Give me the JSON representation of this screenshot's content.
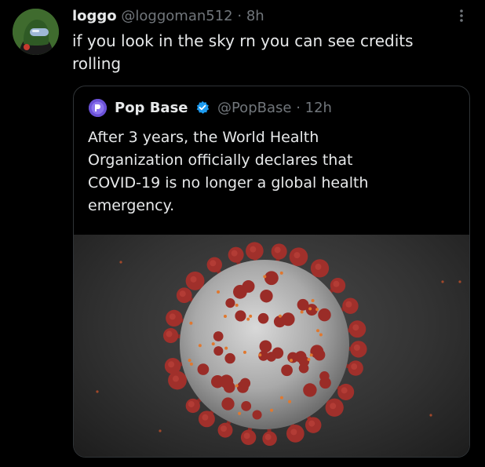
{
  "tweet": {
    "display_name": "loggo",
    "handle": "@loggoman512",
    "separator": "·",
    "time": "8h",
    "text_line1": "if you look in the sky rn you can see credits",
    "text_line2": "rolling"
  },
  "quoted_tweet": {
    "display_name": "Pop Base",
    "handle": "@PopBase",
    "separator": "·",
    "time": "12h",
    "text_line1": "After 3 years, the World Health",
    "text_line2": "Organization officially declares that",
    "text_line3": "COVID-19 is no longer a global health",
    "text_line4": "emergency.",
    "verified": true,
    "image": "coronavirus-illustration"
  },
  "icons": {
    "more": "more-vertical-icon",
    "verified": "verified-badge-icon"
  },
  "colors": {
    "background": "#000000",
    "text": "#e7e9ea",
    "muted": "#71767b",
    "verified": "#1d9bf0",
    "virus_spike": "#a0302b"
  }
}
